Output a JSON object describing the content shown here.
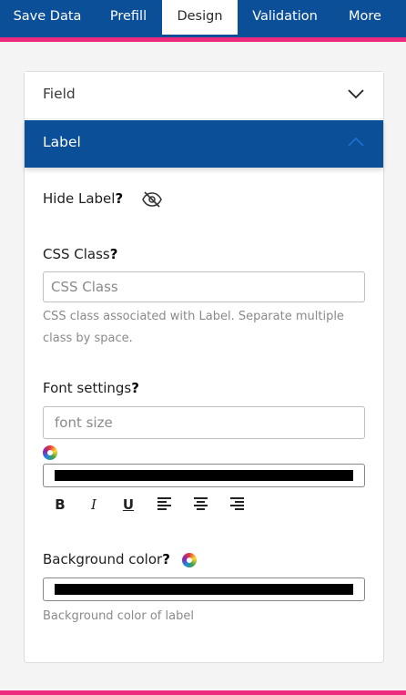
{
  "tabs": [
    {
      "label": "Save Data",
      "active": false
    },
    {
      "label": "Prefill",
      "active": false
    },
    {
      "label": "Design",
      "active": true
    },
    {
      "label": "Validation",
      "active": false
    },
    {
      "label": "More",
      "active": false
    }
  ],
  "accordion": {
    "field": {
      "title": "Field",
      "expanded": false,
      "icon": "chevron-down-icon"
    },
    "label": {
      "title": "Label",
      "expanded": true,
      "icon": "chevron-up-icon"
    }
  },
  "label_section": {
    "hide_label": {
      "label": "Hide Label",
      "help": "?",
      "icon": "eye-off-icon"
    },
    "css_class": {
      "label": "CSS Class",
      "help": "?",
      "placeholder": "CSS Class",
      "value": "",
      "help_text": "CSS class associated with Label. Separate multiple class by space."
    },
    "font_settings": {
      "label": "Font settings",
      "help": "?",
      "size_placeholder": "font size",
      "color_value": "#000000",
      "color_icon": "color-wheel-icon",
      "format_buttons": {
        "bold": "B",
        "italic": "I",
        "underline": "U"
      },
      "align_icons": [
        "align-left-icon",
        "align-center-icon",
        "align-right-icon"
      ]
    },
    "background_color": {
      "label": "Background color",
      "help": "?",
      "color_value": "#000000",
      "color_icon": "color-wheel-icon",
      "help_text": "Background color of label"
    }
  },
  "colors": {
    "primary": "#0b4f99",
    "accent": "#ec2b7f"
  }
}
